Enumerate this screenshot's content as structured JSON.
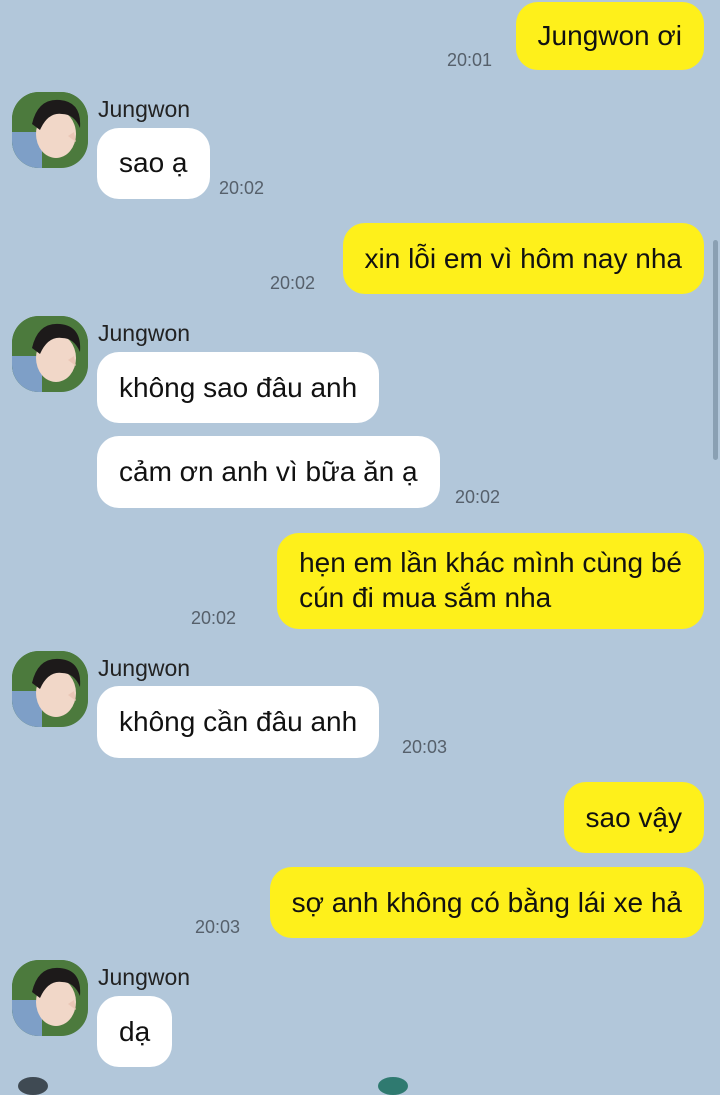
{
  "contact": {
    "name": "Jungwon"
  },
  "messages": [
    {
      "sender": "me",
      "text": "Jungwon ơi",
      "time": "20:01"
    },
    {
      "sender": "Jungwon",
      "text": "sao ạ",
      "time": "20:02"
    },
    {
      "sender": "me",
      "text": "xin lỗi em vì hôm nay nha",
      "time": "20:02"
    },
    {
      "sender": "Jungwon",
      "text": "không sao đâu anh",
      "time": ""
    },
    {
      "sender": "Jungwon",
      "text": "cảm ơn anh vì bữa ăn ạ",
      "time": "20:02"
    },
    {
      "sender": "me",
      "text_line1": "hẹn em lần khác mình cùng bé",
      "text_line2": "cún đi mua sắm nha",
      "time": "20:02"
    },
    {
      "sender": "Jungwon",
      "text": "không cần đâu anh",
      "time": "20:03"
    },
    {
      "sender": "me",
      "text": "sao vậy",
      "time": ""
    },
    {
      "sender": "me",
      "text": "sợ anh không có bằng lái xe hả",
      "time": "20:03"
    },
    {
      "sender": "Jungwon",
      "text": "dạ",
      "time": ""
    }
  ],
  "colors": {
    "background": "#b2c7da",
    "my_bubble": "#fef01b",
    "their_bubble": "#ffffff"
  }
}
